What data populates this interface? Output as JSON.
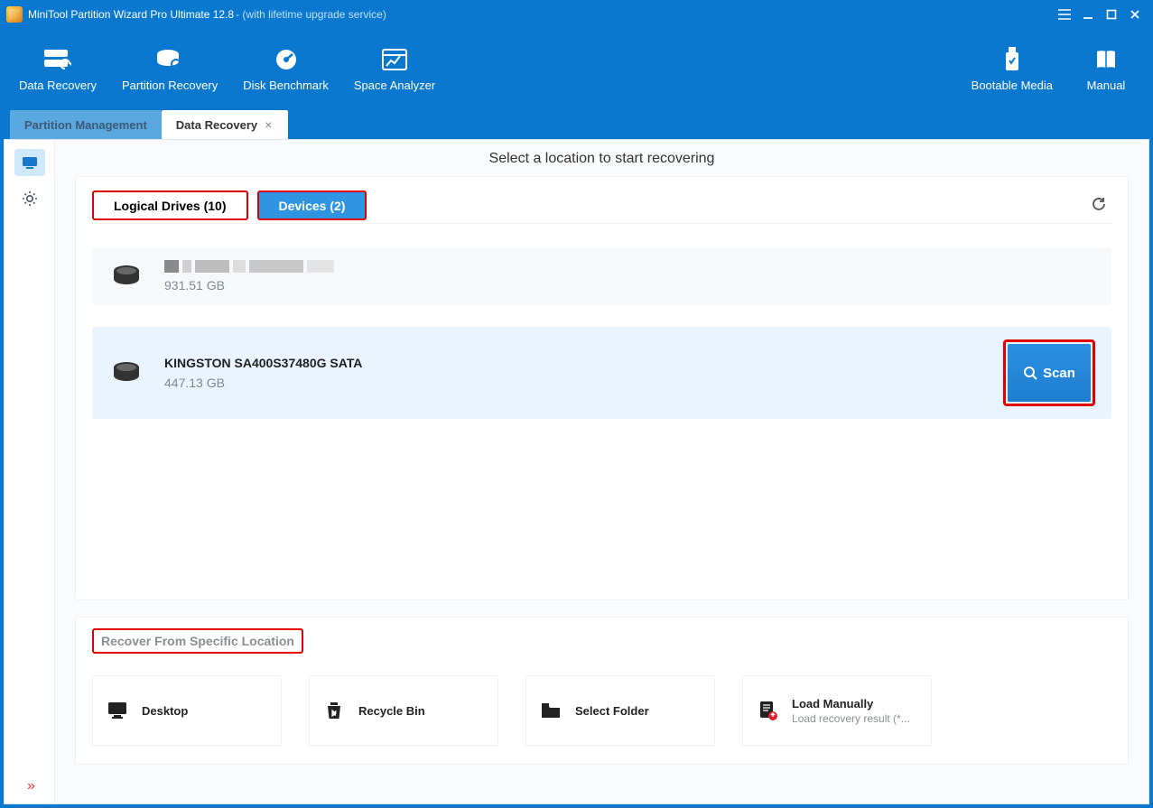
{
  "title": {
    "main": "MiniTool Partition Wizard Pro Ultimate 12.8",
    "suffix": " - (with lifetime upgrade service)"
  },
  "toolbar": {
    "left": [
      {
        "id": "data-recovery",
        "label": "Data Recovery"
      },
      {
        "id": "partition-recovery",
        "label": "Partition Recovery"
      },
      {
        "id": "disk-benchmark",
        "label": "Disk Benchmark"
      },
      {
        "id": "space-analyzer",
        "label": "Space Analyzer"
      }
    ],
    "right": [
      {
        "id": "bootable-media",
        "label": "Bootable Media"
      },
      {
        "id": "manual",
        "label": "Manual"
      }
    ]
  },
  "tabs": [
    {
      "id": "partition-management",
      "label": "Partition Management",
      "active": false,
      "closable": false
    },
    {
      "id": "data-recovery-tab",
      "label": "Data Recovery",
      "active": true,
      "closable": true
    }
  ],
  "heading": "Select a location to start recovering",
  "filters": {
    "logical": "Logical Drives (10)",
    "devices": "Devices (2)"
  },
  "devices": [
    {
      "name_redacted": true,
      "size": "931.51 GB",
      "selected": false,
      "name": ""
    },
    {
      "name_redacted": false,
      "size": "447.13 GB",
      "selected": true,
      "name": "KINGSTON SA400S37480G SATA"
    }
  ],
  "scan_label": "Scan",
  "recover_section_title": "Recover From Specific Location",
  "cards": [
    {
      "id": "desktop",
      "label": "Desktop"
    },
    {
      "id": "recycle-bin",
      "label": "Recycle Bin"
    },
    {
      "id": "select-folder",
      "label": "Select Folder"
    },
    {
      "id": "load-manually",
      "label": "Load Manually",
      "sub": "Load recovery result (*..."
    }
  ]
}
